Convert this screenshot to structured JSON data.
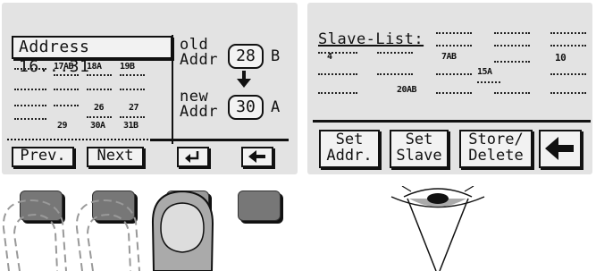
{
  "address_screen": {
    "title": "Address 16...31",
    "row1": {
      "a": "17AB",
      "b": "18A",
      "c": "19B"
    },
    "row3": {
      "a": "26",
      "b": "27"
    },
    "row4": {
      "a": "29",
      "b": "30A",
      "c": "31B"
    },
    "old_label": "old\nAddr",
    "old_value": "28",
    "old_suffix": "B",
    "new_label": "new\nAddr",
    "new_value": "30",
    "new_suffix": "A",
    "softkeys": {
      "prev": "Prev.",
      "next": "Next"
    }
  },
  "slave_screen": {
    "title": "Slave-List:",
    "entries": {
      "e1": "4",
      "e2": "7AB",
      "e3": "10",
      "e4": "15A",
      "e5": "20AB"
    },
    "softkeys": {
      "set_addr": "Set\nAddr.",
      "set_slave": "Set\nSlave",
      "store_delete": "Store/\nDelete"
    }
  }
}
